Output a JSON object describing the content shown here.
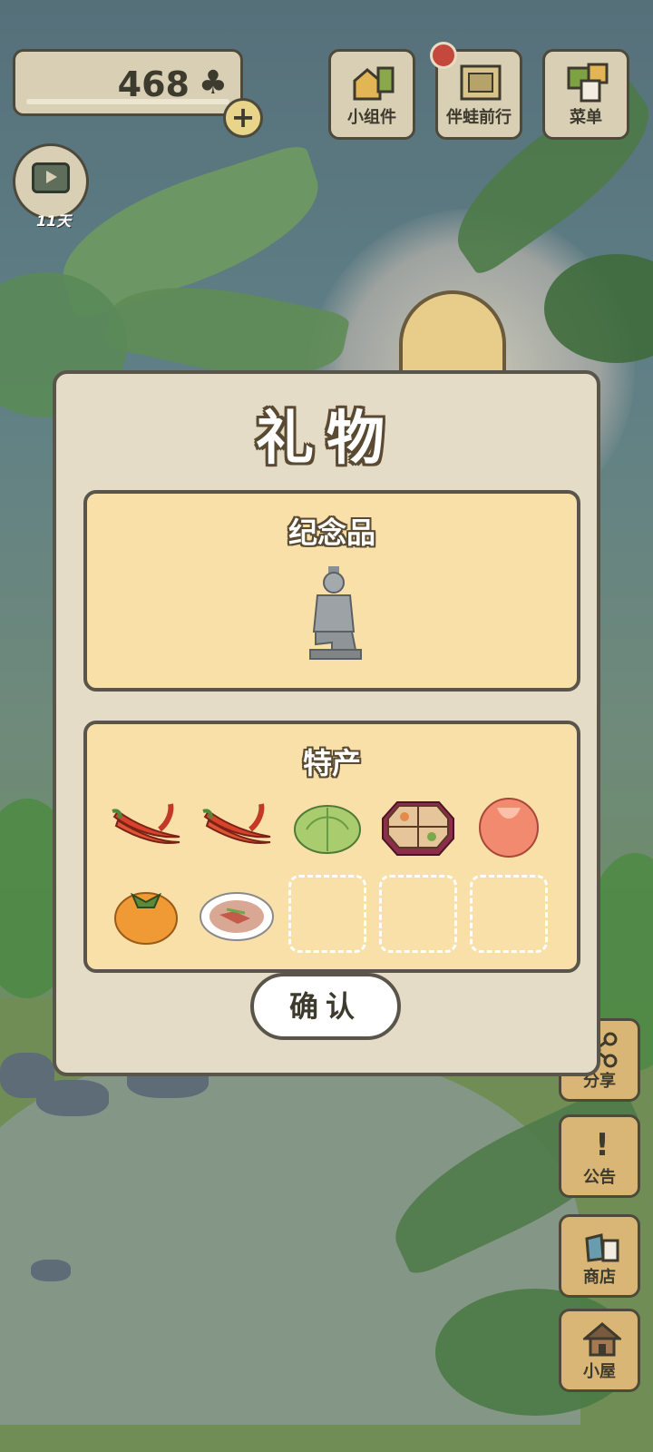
{
  "hud": {
    "clover_count": "468",
    "clover_symbol": "♣",
    "add_symbol": "+",
    "tv_days_label": "11天"
  },
  "top_buttons": [
    {
      "label": "小组件",
      "icon": "widget-icon"
    },
    {
      "label": "伴蛙前行",
      "icon": "journal-icon"
    },
    {
      "label": "菜单",
      "icon": "menu-cards-icon"
    }
  ],
  "side_buttons": [
    {
      "label": "分享",
      "icon": "share-icon"
    },
    {
      "label": "公告",
      "icon": "exclamation-icon"
    },
    {
      "label": "商店",
      "icon": "shop-bag-icon"
    },
    {
      "label": "小屋",
      "icon": "house-icon"
    }
  ],
  "dialog": {
    "title": "礼物",
    "souvenir": {
      "title": "纪念品",
      "items": [
        "terracotta-warrior-icon"
      ]
    },
    "specialty": {
      "title": "特产",
      "items": [
        "chili-pepper-icon",
        "chili-pepper-icon",
        "cabbage-icon",
        "bento-box-icon",
        "peach-icon",
        "persimmon-icon",
        "dish-plate-icon"
      ],
      "empty_slots": 3
    },
    "confirm_label": "确认"
  },
  "colors": {
    "panel_bg": "#e4dcc6",
    "section_bg": "#f8e0a8",
    "border": "#59554a",
    "notification": "#c4483c"
  }
}
